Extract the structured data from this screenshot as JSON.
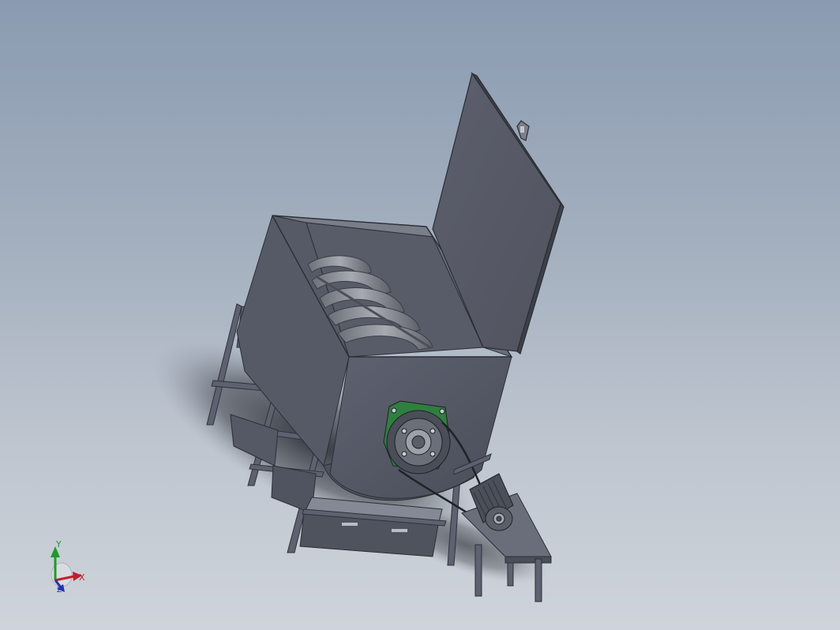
{
  "viewport": {
    "background_top": "#8a9bb1",
    "background_bottom": "#cfd4db"
  },
  "model": {
    "name": "mixer-machine",
    "colors": {
      "body": "#585c68",
      "body_dark": "#3f434e",
      "body_light": "#6b6f7c",
      "lid": "#565966",
      "frame": "#5d6170",
      "motor": "#4b4f59",
      "flange": "#2f7f3f",
      "shadow": "#2e3138"
    }
  },
  "triad": {
    "x_label": "X",
    "y_label": "Y",
    "z_label": "Z",
    "x_color": "#c0202a",
    "y_color": "#1f9a2c",
    "z_color": "#2533a8"
  }
}
